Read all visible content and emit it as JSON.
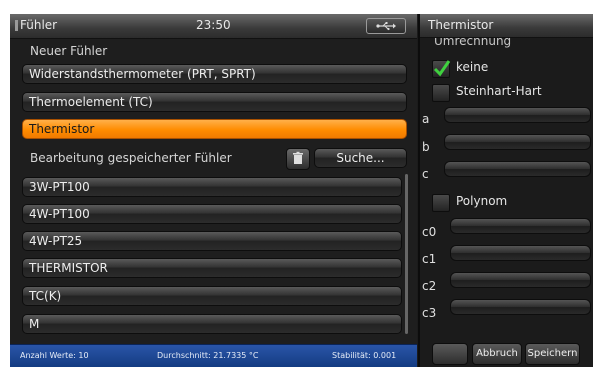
{
  "left": {
    "title": "Fühler",
    "clock": "23:50",
    "new_section": "Neuer Fühler",
    "sensor_types": [
      {
        "label": "Widerstandsthermometer (PRT, SPRT)",
        "selected": false
      },
      {
        "label": "Thermoelement (TC)",
        "selected": false
      },
      {
        "label": "Thermistor",
        "selected": true
      }
    ],
    "saved_section": "Bearbeitung gespeicherter Fühler",
    "search_label": "Suche...",
    "saved_sensors": [
      "3W-PT100",
      "4W-PT100",
      "4W-PT25",
      "THERMISTOR",
      "TC(K)",
      "M"
    ]
  },
  "status": {
    "count": "Anzahl Werte: 10",
    "average": "Durchschnitt: 21.7335 °C",
    "stability": "Stabilität: 0.001"
  },
  "right": {
    "title": "Thermistor",
    "conversion_label": "Umrechnung",
    "options": {
      "none": "keine",
      "steinhart": "Steinhart-Hart",
      "polynom": "Polynom"
    },
    "steinhart_fields": [
      "a",
      "b",
      "c"
    ],
    "polynom_fields": [
      "c0",
      "c1",
      "c2",
      "c3"
    ],
    "cancel_label": "Abbruch",
    "save_label": "Speichern"
  },
  "colors": {
    "accent": "#ff8c00",
    "status_bar": "#1d4a9a",
    "check": "#3fd13f"
  }
}
